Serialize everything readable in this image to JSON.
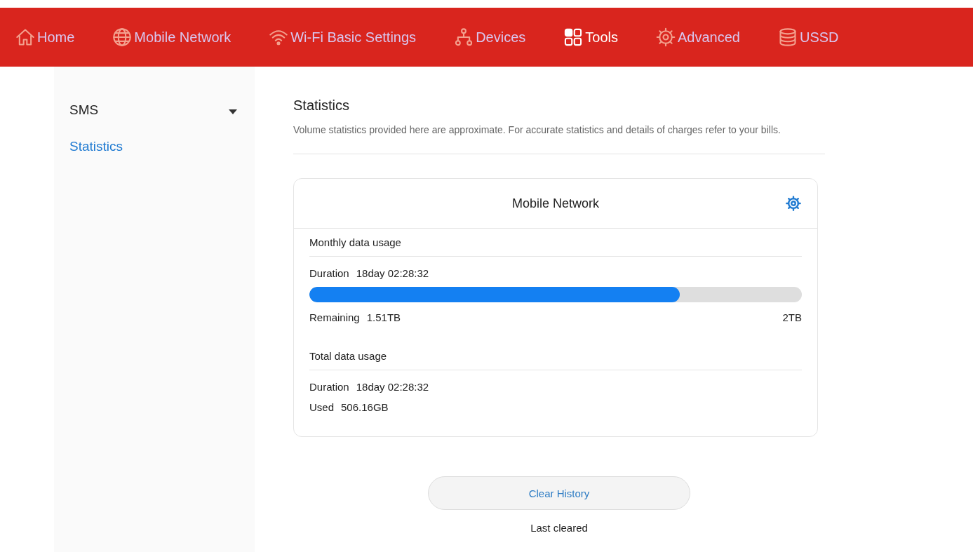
{
  "nav": [
    {
      "label": "Home",
      "selected": false
    },
    {
      "label": "Mobile Network",
      "selected": false
    },
    {
      "label": "Wi-Fi Basic Settings",
      "selected": false
    },
    {
      "label": "Devices",
      "selected": false
    },
    {
      "label": "Tools",
      "selected": true
    },
    {
      "label": "Advanced",
      "selected": false
    },
    {
      "label": "USSD",
      "selected": false
    }
  ],
  "sidebar": {
    "items": [
      {
        "label": "SMS",
        "kind": "group",
        "selected": false
      },
      {
        "label": "Statistics",
        "kind": "link",
        "selected": true
      }
    ]
  },
  "page": {
    "title": "Statistics",
    "description": "Volume statistics provided here are approximate. For accurate statistics and details of charges refer to your bills."
  },
  "card": {
    "title": "Mobile Network",
    "monthly": {
      "heading": "Monthly data usage",
      "duration_label": "Duration",
      "duration": "18day 02:28:32",
      "level": 0.752,
      "remaining_label": "Remaining",
      "remaining": "1.51TB",
      "limit": "2TB"
    },
    "total": {
      "heading": "Total data usage",
      "duration_label": "Duration",
      "duration": "18day 02:28:32",
      "used_label": "Used",
      "used": "506.16GB"
    }
  },
  "clear_button": "Clear History",
  "last_cleared": "Last cleared"
}
